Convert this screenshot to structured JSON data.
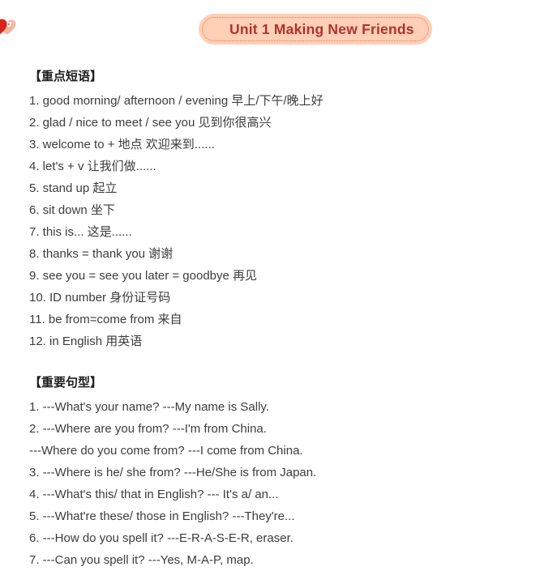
{
  "page": {
    "background_color": "#ffffff",
    "text_color": "#3d3d3d"
  },
  "banner": {
    "icon": "heart-icon",
    "title": "Unit 1 Making New Friends",
    "pill_color": "#ffcfb6",
    "title_color": "#b0322c",
    "border_color": "#e8795a",
    "heart_color": "#d9261c"
  },
  "sections": [
    {
      "heading": "【重点短语】",
      "items": [
        "1. good morning/ afternoon / evening 早上/下午/晚上好",
        "2. glad / nice to meet / see you  见到你很高兴",
        "3. welcome to + 地点   欢迎来到......",
        "4. let's + v  让我们做......",
        "5. stand up 起立",
        "6. sit down 坐下",
        "7. this is...  这是......",
        "8. thanks = thank you 谢谢",
        "9. see you = see you later = goodbye 再见",
        "10. ID number 身份证号码",
        "11. be from=come from 来自",
        "12. in English 用英语"
      ]
    },
    {
      "heading": "【重要句型】",
      "items": [
        "1. ---What's your name? ---My name is Sally.",
        "2. ---Where are you from? ---I'm from China.",
        "---Where do you come from? ---I come from China.",
        "3. ---Where is he/ she from? ---He/She is from Japan.",
        "4. ---What's this/ that in English? --- It's a/ an...",
        "5. ---What're these/ those in English? ---They're...",
        "6. ---How do you spell it? ---E-R-A-S-E-R, eraser.",
        "7. ---Can you spell it? ---Yes, M-A-P, map."
      ]
    }
  ]
}
